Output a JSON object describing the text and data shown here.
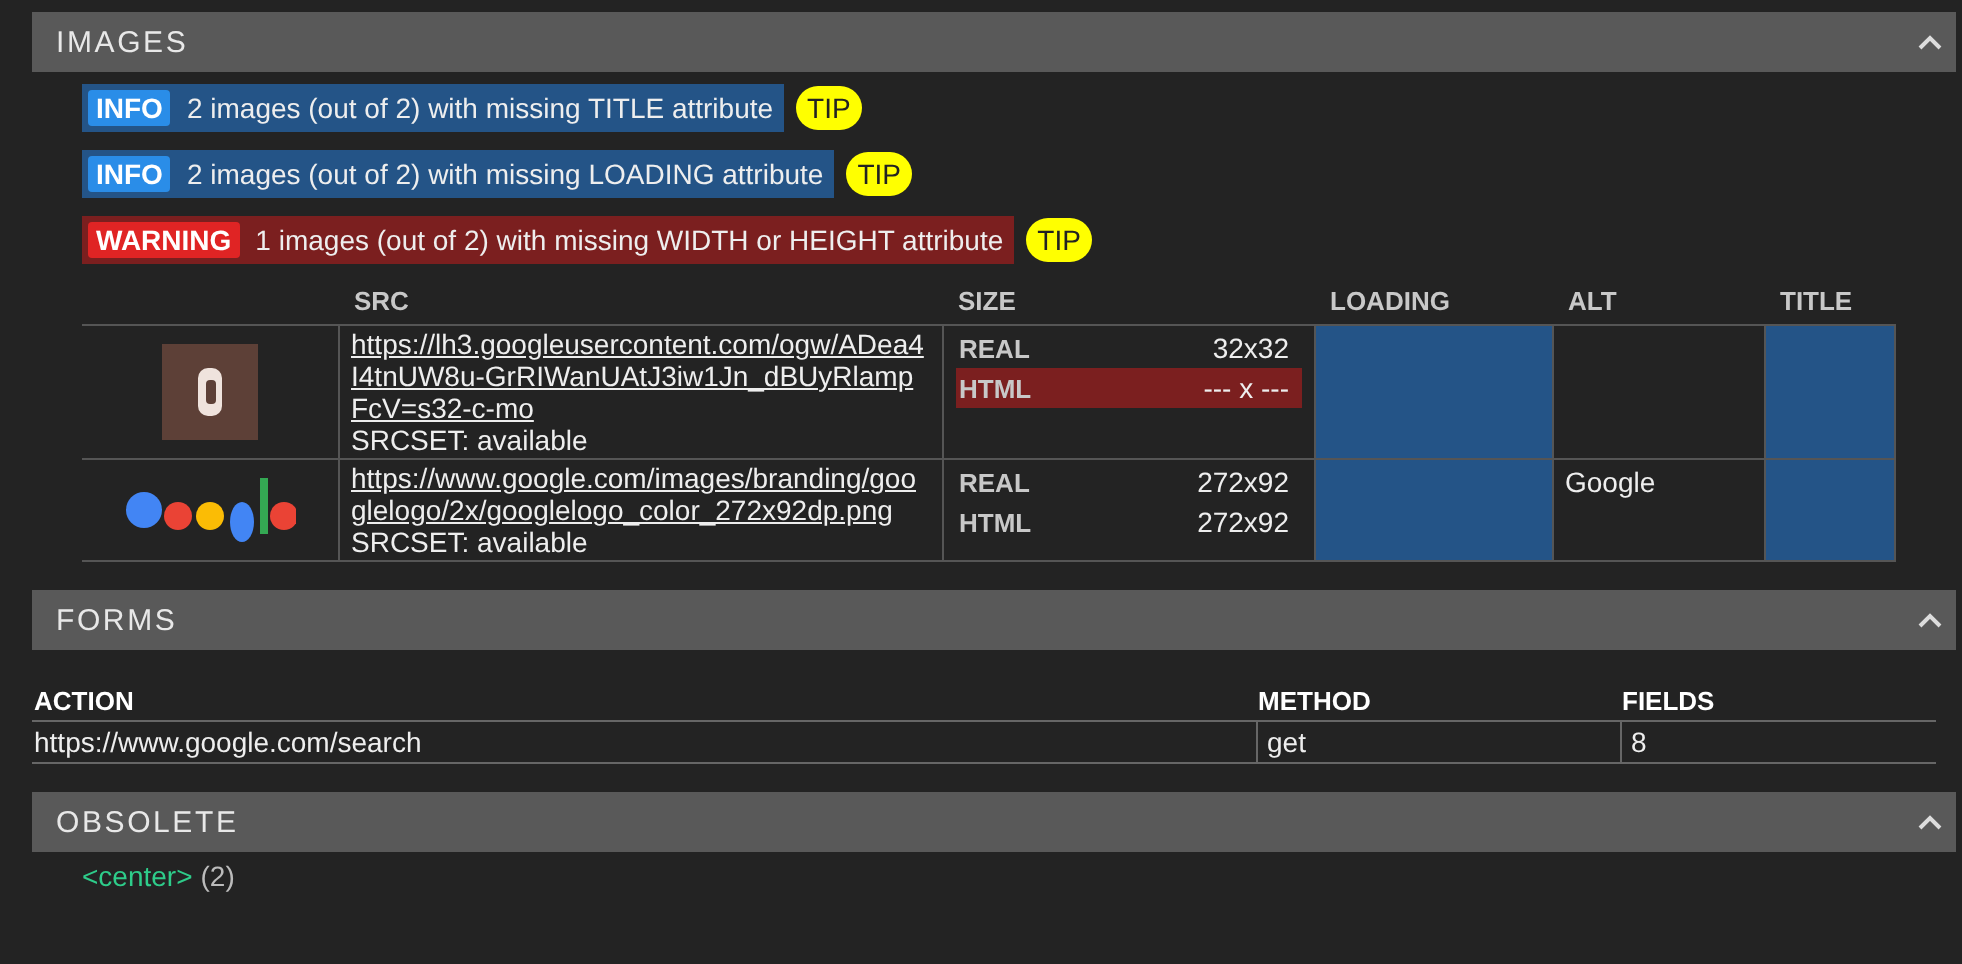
{
  "sections": [
    {
      "kind": "images",
      "title": "IMAGES",
      "expanded": true,
      "messages": [
        {
          "kind": "info",
          "badge": "INFO",
          "text": "2 images (out of 2) with missing TITLE attribute",
          "tip": "TIP"
        },
        {
          "kind": "info",
          "badge": "INFO",
          "text": "2 images (out of 2) with missing LOADING attribute",
          "tip": "TIP"
        },
        {
          "kind": "warning",
          "badge": "WARNING",
          "text": "1 images (out of 2) with missing WIDTH or HEIGHT attribute",
          "tip": "TIP"
        }
      ],
      "columns": [
        "SRC",
        "SIZE",
        "LOADING",
        "ALT",
        "TITLE"
      ],
      "rows": [
        {
          "thumb": {
            "kind": "picture"
          },
          "src": "https://lh3.googleusercontent.com/ogw/ADea4I4tnUW8u-GrRIWanUAtJ3iw1Jn_dBUyRlampFcV=s32-c-mo",
          "srcset": "SRCSET: available",
          "sizes": [
            {
              "label": "REAL",
              "value": "32x32",
              "invalid": false
            },
            {
              "label": "HTML",
              "value": "--- x ---",
              "invalid": true
            }
          ],
          "loading": {
            "missing": true
          },
          "alt": {
            "missing": false
          },
          "title": {
            "missing": true
          }
        },
        {
          "thumb": {
            "kind": "picture"
          },
          "src": "https://www.google.com/images/branding/googlelogo/2x/googlelogo_color_272x92dp.png",
          "srcset": "SRCSET: available",
          "sizes": [
            {
              "label": "REAL",
              "value": "272x92",
              "invalid": false
            },
            {
              "label": "HTML",
              "value": "272x92",
              "invalid": false
            }
          ],
          "loading": {
            "missing": true
          },
          "alt": {
            "value": "Google",
            "missing": false
          },
          "title": {
            "missing": true
          }
        }
      ]
    },
    {
      "kind": "forms",
      "title": "FORMS",
      "expanded": true,
      "columns": [
        "ACTION",
        "METHOD",
        "FIELDS"
      ],
      "rows": [
        [
          "https://www.google.com/search",
          "get",
          "8"
        ]
      ]
    },
    {
      "kind": "obsolete",
      "title": "OBSOLETE",
      "expanded": true,
      "items": [
        {
          "tag": "<center>",
          "count": "(2)"
        }
      ]
    }
  ]
}
